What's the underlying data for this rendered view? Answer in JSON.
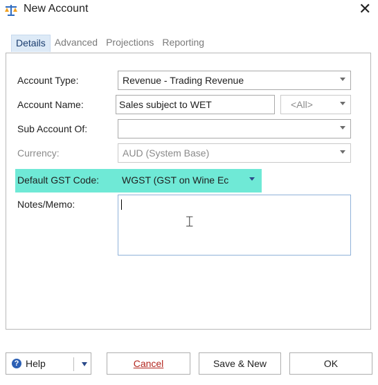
{
  "window": {
    "title": "New Account",
    "close_icon": "close-icon"
  },
  "tabs": [
    {
      "label": "Details",
      "active": true
    },
    {
      "label": "Advanced",
      "active": false
    },
    {
      "label": "Projections",
      "active": false
    },
    {
      "label": "Reporting",
      "active": false
    }
  ],
  "form": {
    "account_type": {
      "label": "Account Type:",
      "value": "Revenue - Trading Revenue"
    },
    "account_name": {
      "label": "Account Name:",
      "value": "Sales subject to WET",
      "scope_value": "<All>"
    },
    "sub_account_of": {
      "label": "Sub Account Of:",
      "value": ""
    },
    "currency": {
      "label": "Currency:",
      "value": "AUD (System Base)"
    },
    "default_gst_code": {
      "label": "Default GST Code:",
      "value": "WGST (GST on Wine Ec"
    },
    "notes": {
      "label": "Notes/Memo:",
      "value": ""
    }
  },
  "buttons": {
    "help": "Help",
    "cancel": "Cancel",
    "save_new": "Save & New",
    "ok": "OK"
  },
  "colors": {
    "highlight": "#6fe9d6",
    "active_tab": "#ddeaf7",
    "cancel_text": "#b3261e"
  }
}
